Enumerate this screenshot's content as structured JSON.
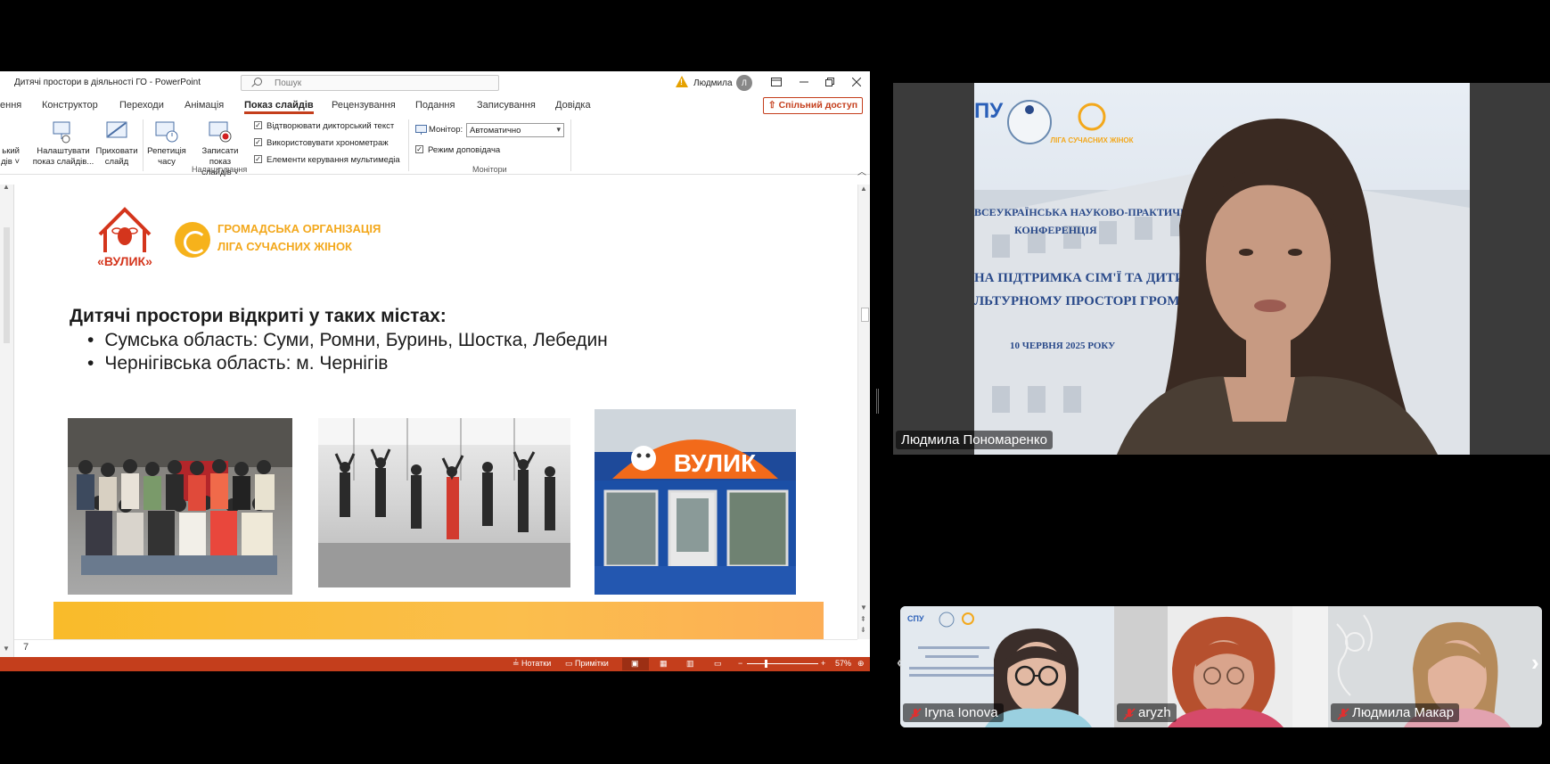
{
  "ppt": {
    "window_title": "Дитячі простори в діяльності ГО  -  PowerPoint",
    "search_placeholder": "Пошук",
    "user_name": "Людмила",
    "user_initial": "Л",
    "tabs": [
      "ення",
      "Конструктор",
      "Переходи",
      "Анімація",
      "Показ слайдів",
      "Рецензування",
      "Подання",
      "Записування",
      "Довідка"
    ],
    "share_label": "Спільний доступ",
    "ribbon": {
      "cut_off_button": [
        "ький",
        "дів ˅"
      ],
      "setup_show": [
        "Налаштувати",
        "показ слайдів..."
      ],
      "hide_slide": [
        "Приховати",
        "слайд"
      ],
      "rehearse": [
        "Репетиція",
        "часу"
      ],
      "record": [
        "Записати показ",
        "слайдів ˅"
      ],
      "checkboxes": [
        "Відтворювати дикторський текст",
        "Використовувати хронометраж",
        "Елементи керування мультимедіа"
      ],
      "setup_group": "Налаштування",
      "monitor_label": "Монітор:",
      "monitor_value": "Автоматично",
      "presenter_view": "Режим доповідача",
      "monitors_group": "Монітори"
    },
    "slide": {
      "logo_vulyk": "«ВУЛИК»",
      "org_line1": "ГРОМАДСЬКА ОРГАНІЗАЦІЯ",
      "org_line2": "ЛІГА СУЧАСНИХ ЖІНОК",
      "heading": "Дитячі простори відкриті у таких містах:",
      "bullets": [
        "Сумська область: Суми, Ромни, Буринь, Шостка, Лебедин",
        "Чернігівська область: м. Чернігів"
      ],
      "sign_text": "ВУЛИК"
    },
    "slide_number": "7",
    "status": {
      "notes": "Нотатки",
      "comments": "Примітки",
      "zoom": "57%"
    }
  },
  "main_video": {
    "name": "Людмила Пономаренко",
    "backdrop_lines": [
      "ВСЕУКРАЇНСЬКА НАУКОВО-ПРАКТИЧНА",
      "КОНФЕРЕНЦІЯ",
      "НА ПІДТРИМКА СІМ'Ї ТА ДИТИН",
      "ЛЬТУРНОМУ ПРОСТОРІ  ГРОМА",
      "10 ЧЕРВНЯ 2025 РОКУ"
    ],
    "backdrop_logo": "ЛІГА СУЧАСНИХ ЖІНОК",
    "backdrop_spu": "ПУ"
  },
  "thumbnails": [
    {
      "name": "Iryna Ionova"
    },
    {
      "name": "aryzh"
    },
    {
      "name": "Людмила Макар"
    }
  ],
  "thumb_spu": "СПУ",
  "colors": {
    "ppt_accent": "#c43e1c",
    "liga_orange": "#f3a81c",
    "vulyk_red": "#d4351c"
  }
}
